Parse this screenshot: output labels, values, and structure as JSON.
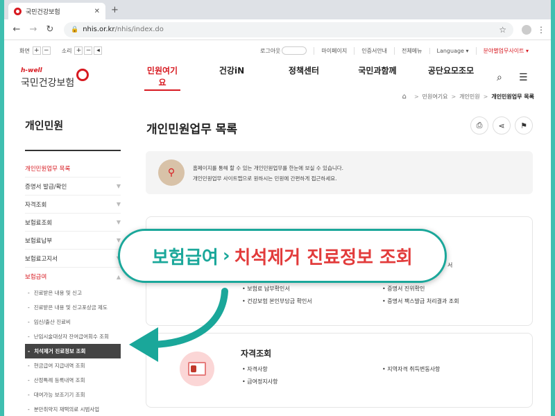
{
  "browser": {
    "tab_title": "국민건강보험",
    "tab_close": "✕",
    "new_tab": "+",
    "url_host": "nhis.or.kr",
    "url_path": "/nhis/index.do"
  },
  "util": {
    "screen_label": "화면",
    "sound_label": "소리",
    "plus": "+",
    "minus": "−",
    "login": "로그아웃",
    "links": [
      "마이페이지",
      "인증서안내",
      "전체메뉴",
      "Language ▾"
    ],
    "family_site": "분야별업무사이트 ▾"
  },
  "logo": {
    "hwell": "h-well",
    "name": "국민건강보험"
  },
  "gnb": [
    "민원여기요",
    "건강iN",
    "정책센터",
    "국민과함께",
    "공단요모조모"
  ],
  "breadcrumb": {
    "items": [
      "민원여기요",
      "개인민원"
    ],
    "current": "개인민원업무 목록",
    "sep": ">"
  },
  "sidebar": {
    "title": "개인민원",
    "items": [
      {
        "label": "개인민원업무 목록",
        "chev": ""
      },
      {
        "label": "증명서 발급/확인",
        "chev": "▼"
      },
      {
        "label": "자격조회",
        "chev": "▼"
      },
      {
        "label": "보험료조회",
        "chev": "▼"
      },
      {
        "label": "보험료납부",
        "chev": "▼"
      },
      {
        "label": "보험료고지서",
        "chev": "▼"
      },
      {
        "label": "보험급여",
        "chev": "▲"
      }
    ],
    "subs": [
      "진료받은 내용 및 신고",
      "진료받은 내용 및 신고포상금 제도",
      "임신/출산 진료비",
      "난임시술대상자 잔여급여회수 조회",
      "치석제거 진료정보 조회",
      "현금급여 지급내역 조회",
      "산정특례 등록내역 조회",
      "대여가능 보조기기 조회",
      "분만취약지 재택의료 시범사업"
    ]
  },
  "main": {
    "title": "개인민원업무 목록",
    "info_lines": [
      "홈페이지를 통해 할 수 있는 개인민원업무를 한눈에 보실 수 있습니다.",
      "개인민원업무 사이트맵으로 원하시는 민원에 간편하게 접근하세요."
    ],
    "card1_items": [
      "보험료 납부확인서",
      "건강보험 본인부담금 확인서",
      "증명서 진위확인",
      "증명서 팩스발급 처리결과 조회",
      "서"
    ],
    "card2": {
      "title": "자격조회",
      "items": [
        "자격사항",
        "급여정지사항",
        "지역자격 취득변동사항"
      ]
    }
  },
  "callout": {
    "part1": "보험급여",
    "sep": "›",
    "part2": "치석제거 진료정보 조회"
  },
  "colors": {
    "brand_red": "#d71920",
    "teal": "#1aa79a",
    "callout_red": "#e23b3b"
  }
}
